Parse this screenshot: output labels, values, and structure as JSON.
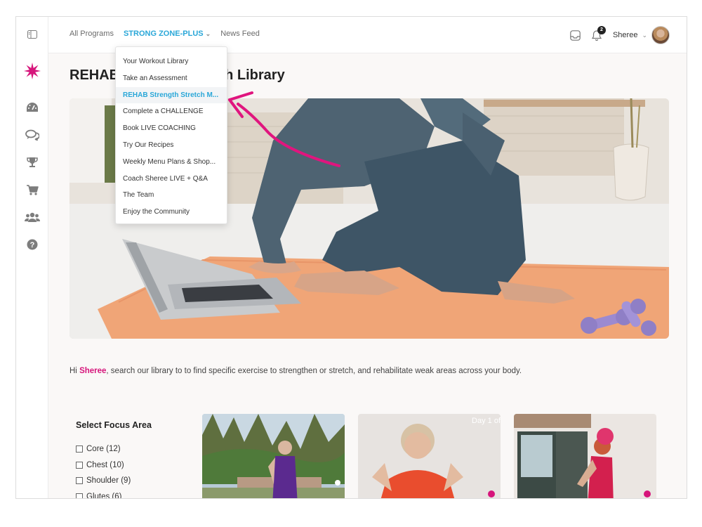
{
  "nav": {
    "all_programs": "All Programs",
    "active_program": "STRONG ZONE-PLUS",
    "news_feed": "News Feed"
  },
  "dropdown": {
    "items": [
      {
        "label": "Your Workout Library",
        "active": false
      },
      {
        "label": "Take an Assessment",
        "active": false
      },
      {
        "label": "REHAB Strength Stretch M...",
        "active": true
      },
      {
        "label": "Complete a CHALLENGE",
        "active": false
      },
      {
        "label": "Book LIVE COACHING",
        "active": false
      },
      {
        "label": "Try Our Recipes",
        "active": false
      },
      {
        "label": "Weekly Menu Plans & Shop...",
        "active": false
      },
      {
        "label": "Coach Sheree LIVE + Q&A",
        "active": false
      },
      {
        "label": "The Team",
        "active": false
      },
      {
        "label": "Enjoy the Community",
        "active": false
      }
    ]
  },
  "header": {
    "notification_count": "2",
    "username": "Sheree"
  },
  "page": {
    "title": "REHAB Strength Stretch Library",
    "intro_prefix": "Hi ",
    "intro_name": "Sheree",
    "intro_suffix": ", search our library to to find specific exercise to strengthen or stretch, and rehabilitate weak areas across your body."
  },
  "focus": {
    "title": "Select Focus Area",
    "items": [
      "Core (12)",
      "Chest (10)",
      "Shoulder (9)",
      "Glutes (6)"
    ]
  },
  "cards": {
    "card2_overlay": "Day 1 of"
  },
  "icons": {
    "sidebar": [
      "sidebar-toggle-icon",
      "logo-flower-icon",
      "dashboard-icon",
      "chat-icon",
      "trophy-icon",
      "cart-icon",
      "users-icon",
      "help-icon"
    ],
    "header": [
      "inbox-icon",
      "bell-icon",
      "chevron-down-icon"
    ]
  },
  "colors": {
    "accent_blue": "#2aa7d8",
    "brand_pink": "#d6157b",
    "sidebar_icon": "#7d7d7d"
  }
}
